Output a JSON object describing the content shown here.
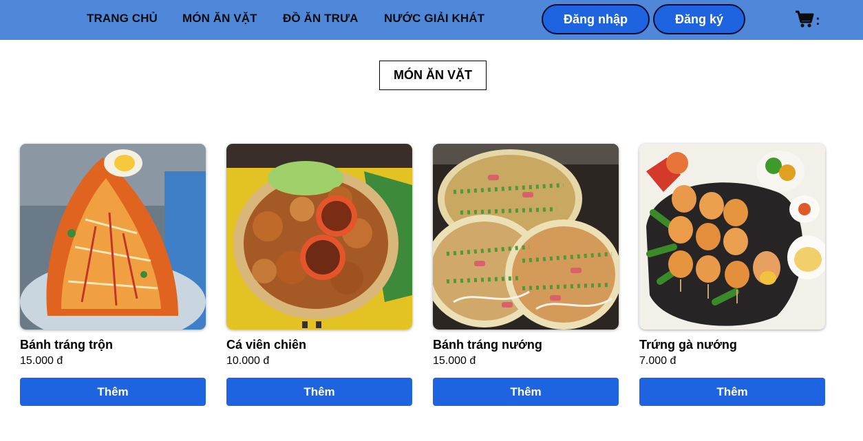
{
  "nav": {
    "links": [
      "TRANG CHỦ",
      "MÓN ĂN VẶT",
      "ĐỒ ĂN TRƯA",
      "NƯỚC GIẢI KHÁT"
    ],
    "login_label": "Đăng nhập",
    "register_label": "Đăng ký",
    "cart_icon": "shopping-cart-icon",
    "cart_suffix": ":"
  },
  "section": {
    "title": "MÓN ĂN VẶT"
  },
  "products": [
    {
      "name": "Bánh tráng trộn",
      "price": "15.000 đ",
      "button": "Thêm",
      "image": "banh-trang-tron-photo"
    },
    {
      "name": "Cá viên chiên",
      "price": "10.000 đ",
      "button": "Thêm",
      "image": "ca-vien-chien-photo"
    },
    {
      "name": "Bánh tráng nướng",
      "price": "15.000 đ",
      "button": "Thêm",
      "image": "banh-trang-nuong-photo"
    },
    {
      "name": "Trứng gà nướng",
      "price": "7.000 đ",
      "button": "Thêm",
      "image": "trung-ga-nuong-photo"
    }
  ],
  "colors": {
    "navbar": "#4f87d9",
    "primary_button": "#1e63e0",
    "button_border": "#0b0b2e"
  }
}
